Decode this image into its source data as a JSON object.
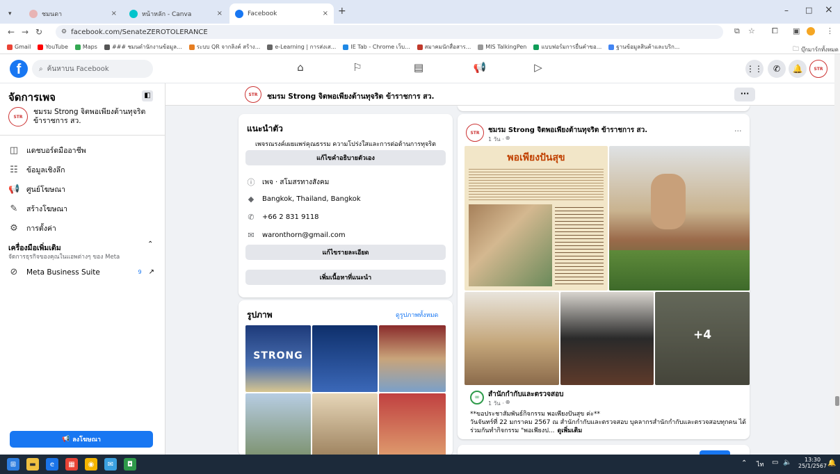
{
  "browser": {
    "tabs": [
      {
        "label": "ชมนดา",
        "active": false
      },
      {
        "label": "หน้าหลัก - Canva",
        "active": false
      },
      {
        "label": "Facebook",
        "active": true
      }
    ],
    "new_tab": "+",
    "window_controls": {
      "minimize": "–",
      "maximize": "□",
      "close": "×"
    },
    "url": "facebook.com/SenateZEROTOLERANCE",
    "bookmarks": [
      "Gmail",
      "YouTube",
      "Maps",
      "### ชมนดำนักงานข้อมูล...",
      "ระบบ QR จากลิงค์ สร้าง...",
      "e-Learning | การส่งเส...",
      "IE Tab - Chrome เว็บ...",
      "สมาคมนักสื่อสาร...",
      "MIS TalkingPen",
      "แบบฟอร์มการยื่นคำขอ...",
      "ฐานข้อมูลสินค้าและบริก..."
    ],
    "bookmarks_folder": "บุ๊กมาร์กทั้งหมด"
  },
  "facebook": {
    "search_placeholder": "ค้นหาบน Facebook",
    "nav_icons": [
      "home-icon",
      "flag-icon",
      "marketplace-icon",
      "megaphone-icon",
      "video-icon"
    ]
  },
  "sidebar": {
    "title": "จัดการเพจ",
    "page_name": "ชมรม Strong จิตพอเพียงต้านทุจริต ข้าราชการ สว.",
    "items": [
      {
        "icon": "dashboard-icon",
        "glyph": "◫",
        "label": "แดชบอร์ดมืออาชีพ"
      },
      {
        "icon": "insights-icon",
        "glyph": "☷",
        "label": "ข้อมูลเชิงลึก"
      },
      {
        "icon": "ads-center-icon",
        "glyph": "📢",
        "label": "ศูนย์โฆษณา"
      },
      {
        "icon": "create-ad-icon",
        "glyph": "✎",
        "label": "สร้างโฆษณา"
      },
      {
        "icon": "settings-icon",
        "glyph": "⚙",
        "label": "การตั้งค่า"
      }
    ],
    "tools_title": "เครื่องมือเพิ่มเติม",
    "tools_subtitle": "จัดการธุรกิจของคุณในแอพต่างๆ ของ Meta",
    "meta_suite": "Meta Business Suite",
    "meta_badge": "9",
    "promote_button": "ลงโฆษณา"
  },
  "pagebar": {
    "name": "ชมรม Strong จิตพอเพียงต้านทุจริต ข้าราชการ สว.",
    "more": "···"
  },
  "intro": {
    "title": "แนะนำตัว",
    "bio": "เพจรณรงค์เผยแพร่คุณธรรม ความโปร่งใสและการต่อต้านการทุจริต",
    "edit_bio": "แก้ไขคำอธิบายตัวเอง",
    "category": "เพจ · สโมสรทางสังคม",
    "location": "Bangkok, Thailand, Bangkok",
    "phone": "+66 2 831 9118",
    "email": "waronthorn@gmail.com",
    "edit_details": "แก้ไขรายละเอียด",
    "add_featured": "เพิ่มเนื้อหาที่แนะนำ"
  },
  "photos": {
    "title": "รูปภาพ",
    "see_all": "ดูรูปภาพทั้งหมด",
    "strong_text": "STRONG"
  },
  "post": {
    "author": "ชมรม Strong จิตพอเพียงต้านทุจริต ข้าราชการ สว.",
    "time": "1 วัน · ",
    "more": "···",
    "poster_title": "พอเพียงปันสุข",
    "more_count": "+4",
    "shared_author": "สำนักกำกับและตรวจสอบ",
    "shared_time": "1 วัน · ",
    "text_line1": "**ขอประชาสัมพันธ์กิจกรรม พอเพียงปันสุข ค่ะ**",
    "text_line2": "วันจันทร์ที่ 22 มกราคม 2567 ณ สำนักกำกับและตรวจสอบ บุคลากรสำนักกำกับและตรวจสอบทุกคน ได้",
    "text_line3": "ร่วมกันทำกิจกรรม \"พอเพียงป...",
    "see_more": "ดูเพิ่มเติม"
  },
  "taskbar": {
    "time": "13:30",
    "date": "25/1/2567"
  },
  "colors": {
    "fb_blue": "#1877f2",
    "taskbar": "#1c2a3a"
  }
}
